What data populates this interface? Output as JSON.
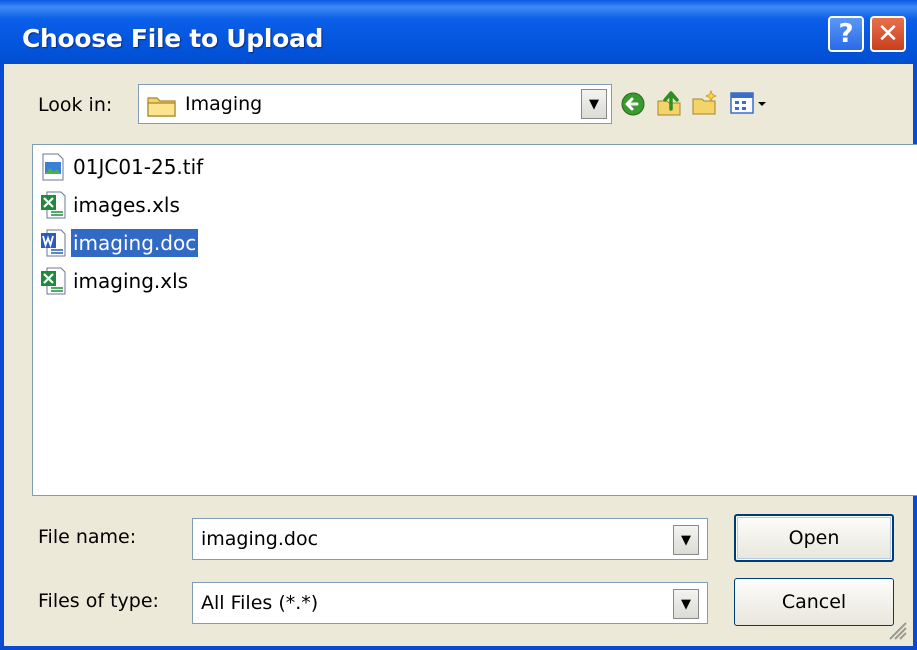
{
  "window": {
    "title": "Choose File to Upload",
    "help_glyph": "?",
    "close_glyph": "✕"
  },
  "lookin": {
    "label": "Look in:",
    "value": "Imaging",
    "folder_icon": "folder-icon"
  },
  "toolbar": {
    "icons": [
      "back-icon",
      "up-folder-icon",
      "new-folder-icon",
      "view-menu-icon"
    ]
  },
  "files": [
    {
      "name": "01JC01-25.tif",
      "icon": "image-file-icon",
      "selected": false
    },
    {
      "name": "images.xls",
      "icon": "excel-file-icon",
      "selected": false
    },
    {
      "name": "imaging.doc",
      "icon": "word-file-icon",
      "selected": true
    },
    {
      "name": "imaging.xls",
      "icon": "excel-file-icon",
      "selected": false
    }
  ],
  "filename": {
    "label": "File name:",
    "value": "imaging.doc"
  },
  "filetype": {
    "label": "Files of type:",
    "value": "All Files (*.*)"
  },
  "buttons": {
    "open": "Open",
    "cancel": "Cancel"
  },
  "colors": {
    "titlebar": "#0252d9",
    "selection": "#316ac5",
    "dialog_bg": "#ece9d8"
  }
}
